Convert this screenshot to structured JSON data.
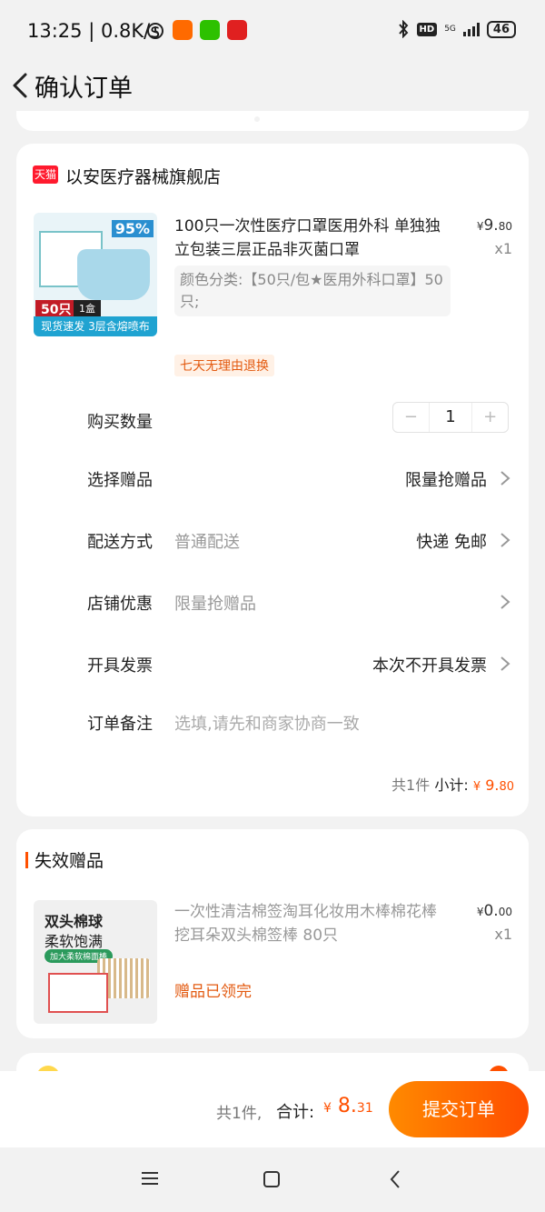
{
  "status_bar": {
    "time": "13:25",
    "speed": "0.8K/s",
    "network": "5G",
    "hd": "HD",
    "battery": "46"
  },
  "header": {
    "title": "确认订单"
  },
  "shop": {
    "badge": "天猫",
    "name": "以安医疗器械旗舰店",
    "product": {
      "image_pct": "95%",
      "image_tag": "50只",
      "image_box": "1盒",
      "image_strip": "现货速发 3层含熔喷布",
      "title": "100只一次性医疗口罩医用外科 单独独立包装三层正品非灭菌口罩",
      "price_symbol": "¥",
      "price_int": "9.",
      "price_dec": "80",
      "qty": "x1",
      "spec": "颜色分类:【50只/包★医用外科口罩】50只;",
      "return_tag": "七天无理由退换"
    },
    "rows": {
      "quantity": {
        "label": "购买数量",
        "minus": "−",
        "value": "1",
        "plus": "+"
      },
      "gift": {
        "label": "选择赠品",
        "value": "限量抢赠品"
      },
      "delivery": {
        "label": "配送方式",
        "sub": "普通配送",
        "value": "快递 免邮"
      },
      "discount": {
        "label": "店铺优惠",
        "sub": "限量抢赠品"
      },
      "invoice": {
        "label": "开具发票",
        "value": "本次不开具发票"
      },
      "note": {
        "label": "订单备注",
        "placeholder": "选填,请先和商家协商一致"
      }
    },
    "subtotal": {
      "count": "共1件",
      "label": "小计:",
      "symbol": "¥",
      "int": "9.",
      "dec": "80"
    }
  },
  "invalid_gift": {
    "title": "失效赠品",
    "image_text1": "双头棉球",
    "image_text2": "柔软饱满",
    "image_pill": "加大柔软棉面棒",
    "name": "一次性清洁棉签淘耳化妆用木棒棉花棒挖耳朵双头棉签棒 80只",
    "price_symbol": "¥",
    "price_int": "0.",
    "price_dec": "00",
    "qty": "x1",
    "status": "赠品已领完"
  },
  "bottom_bar": {
    "count": "共1件,",
    "total_label": "合计:",
    "symbol": "¥",
    "int": "8.",
    "dec": "31",
    "submit": "提交订单"
  },
  "colors": {
    "accent": "#ff5000",
    "tmall": "#ff1a2e"
  }
}
